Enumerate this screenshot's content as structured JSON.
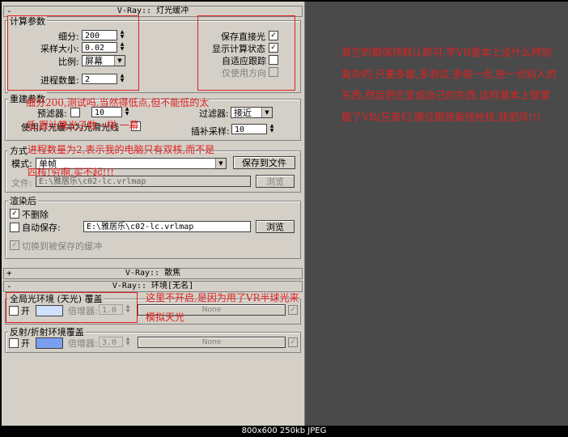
{
  "rollout_light_cache": "V-Ray:: 灯光缓冲",
  "calc_params": {
    "group_title": "计算参数",
    "subdivs_label": "细分:",
    "subdivs_value": "200",
    "sample_size_label": "采样大小:",
    "sample_size_value": "0.02",
    "scale_label": "比例:",
    "scale_value": "屏幕",
    "passes_label": "进程数量:",
    "passes_value": "2",
    "store_direct_label": "保存直接光",
    "show_calc_label": "显示计算状态",
    "adaptive_label": "自适应跟踪",
    "use_dirs_label": "仅使用方向"
  },
  "recon_params": {
    "group_title": "重建参数",
    "prefilter_label": "预滤器:",
    "prefilter_value": "10",
    "filter_label": "过滤器:",
    "filter_value": "接近",
    "use_glossy_label": "使用灯光缓冲为光滑光线",
    "interp_label": "插补采样:",
    "interp_value": "10"
  },
  "mode": {
    "group_title": "方式",
    "mode_label": "模式:",
    "mode_value": "单帧",
    "save_to_file": "保存到文件",
    "file_label": "文件:",
    "file_value": "E:\\雅居乐\\c02-lc.vrlmap",
    "browse": "浏览"
  },
  "after_render": {
    "group_title": "渲染后",
    "dont_delete": "不删除",
    "auto_save": "自动保存:",
    "auto_save_path": "E:\\雅居乐\\c02-lc.vrlmap",
    "browse": "浏览",
    "switch_saved": "切换到被保存的缓冲"
  },
  "rollout_caustics": "V-Ray:: 散焦",
  "rollout_environment": "V-Ray:: 环境[无名]",
  "env": {
    "gi_title": "全局光环境 (天光) 覆盖",
    "on_label": "开",
    "multiplier_label": "倍增器:",
    "gi_mult": "1.0",
    "none": "None",
    "refl_title": "反射/折射环境覆盖",
    "refl_mult": "3.0"
  },
  "colors": {
    "gi_swatch": "#cfe1ff",
    "refl_swatch": "#7a9ef0",
    "annotation": "#e02020"
  },
  "annotations": {
    "right_note": "其它的都保持默认即可,学VR基本上没什么特别复杂的,只要多做,多测试,多偷一点,抢一点别人的东西,然后把它变成自己的东西,这样基本上就掌握了VR(兄弟们,哪位跟我偷钱抢钱,我把风!!)",
    "overlay_line1": "细分200,测试吗,当然得低点,但不能低的太",
    "overlay_line2": "低,跟计算光子数一样,一幕",
    "overlay_line3": "进程数量为2,表示我的电脑只有双核,而不是",
    "overlay_line4": "四核!穷啊,买不起!!!",
    "env_note": "这里不开启,是因为用了VR半球光来模拟天光"
  },
  "status_bar": "800x600 250kb JPEG"
}
